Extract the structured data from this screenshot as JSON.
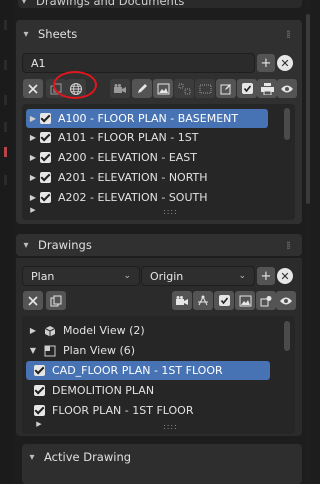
{
  "panel_title": "Drawings and Documents",
  "sheets": {
    "header": "Sheets",
    "search_value": "A1",
    "items": [
      {
        "label": "A100 - FLOOR PLAN - BASEMENT",
        "selected": true
      },
      {
        "label": "A101 - FLOOR PLAN - 1ST",
        "selected": false
      },
      {
        "label": "A200 - ELEVATION - EAST",
        "selected": false
      },
      {
        "label": "A201 - ELEVATION - NORTH",
        "selected": false
      },
      {
        "label": "A202 - ELEVATION - SOUTH",
        "selected": false
      }
    ]
  },
  "drawings": {
    "header": "Drawings",
    "type_value": "Plan",
    "origin_value": "Origin",
    "tree": [
      {
        "label": "Model View (2)",
        "kind": "group",
        "expanded": false
      },
      {
        "label": "Plan View (6)",
        "kind": "group",
        "expanded": true
      },
      {
        "label": "CAD_FLOOR PLAN - 1ST FLOOR",
        "kind": "item",
        "selected": true
      },
      {
        "label": "DEMOLITION PLAN",
        "kind": "item",
        "selected": false
      },
      {
        "label": "FLOOR PLAN - 1ST FLOOR",
        "kind": "item",
        "selected": false
      }
    ]
  },
  "active_drawing": {
    "header": "Active Drawing"
  },
  "buttons": {
    "plus": "+",
    "close": "✕",
    "dots": "::::"
  },
  "colors": {
    "selection": "#4772b3",
    "highlight_ring": "#e0161c",
    "panel": "#303030",
    "list_bg": "#262626"
  }
}
